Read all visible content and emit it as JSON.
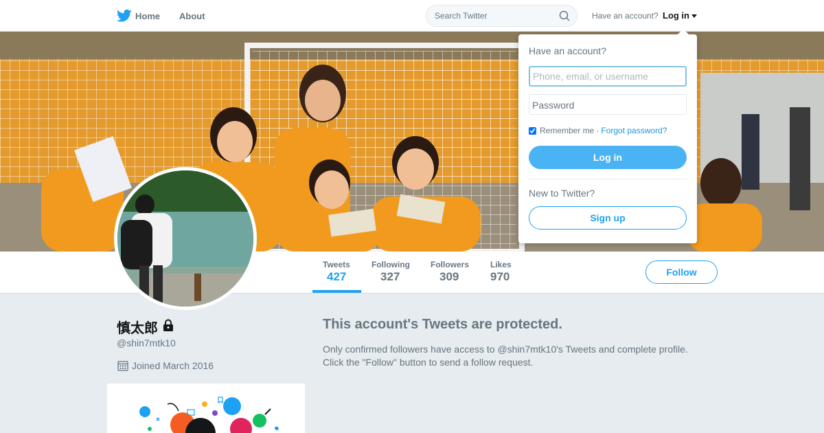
{
  "nav": {
    "home_label": "Home",
    "about_label": "About",
    "search_placeholder": "Search Twitter",
    "have_account": "Have an account?",
    "login_label": "Log in"
  },
  "profile": {
    "name": "慎太郎",
    "handle": "@shin7mtk10",
    "joined": "Joined March 2016"
  },
  "stats": [
    {
      "label": "Tweets",
      "value": "427"
    },
    {
      "label": "Following",
      "value": "327"
    },
    {
      "label": "Followers",
      "value": "309"
    },
    {
      "label": "Likes",
      "value": "970"
    }
  ],
  "follow_label": "Follow",
  "protected": {
    "title": "This account's Tweets are protected.",
    "line1": "Only confirmed followers have access to @shin7mtk10's Tweets and complete profile.",
    "line2": "Click the \"Follow\" button to send a follow request."
  },
  "login_dropdown": {
    "heading": "Have an account?",
    "username_placeholder": "Phone, email, or username",
    "password_label": "Password",
    "remember_label": "Remember me",
    "separator": "·",
    "forgot_label": "Forgot password?",
    "login_button": "Log in",
    "new_label": "New to Twitter?",
    "signup_button": "Sign up"
  },
  "colors": {
    "accent": "#1da1f2",
    "button_fill": "#4ab3f4",
    "background": "#e6ecf0"
  }
}
